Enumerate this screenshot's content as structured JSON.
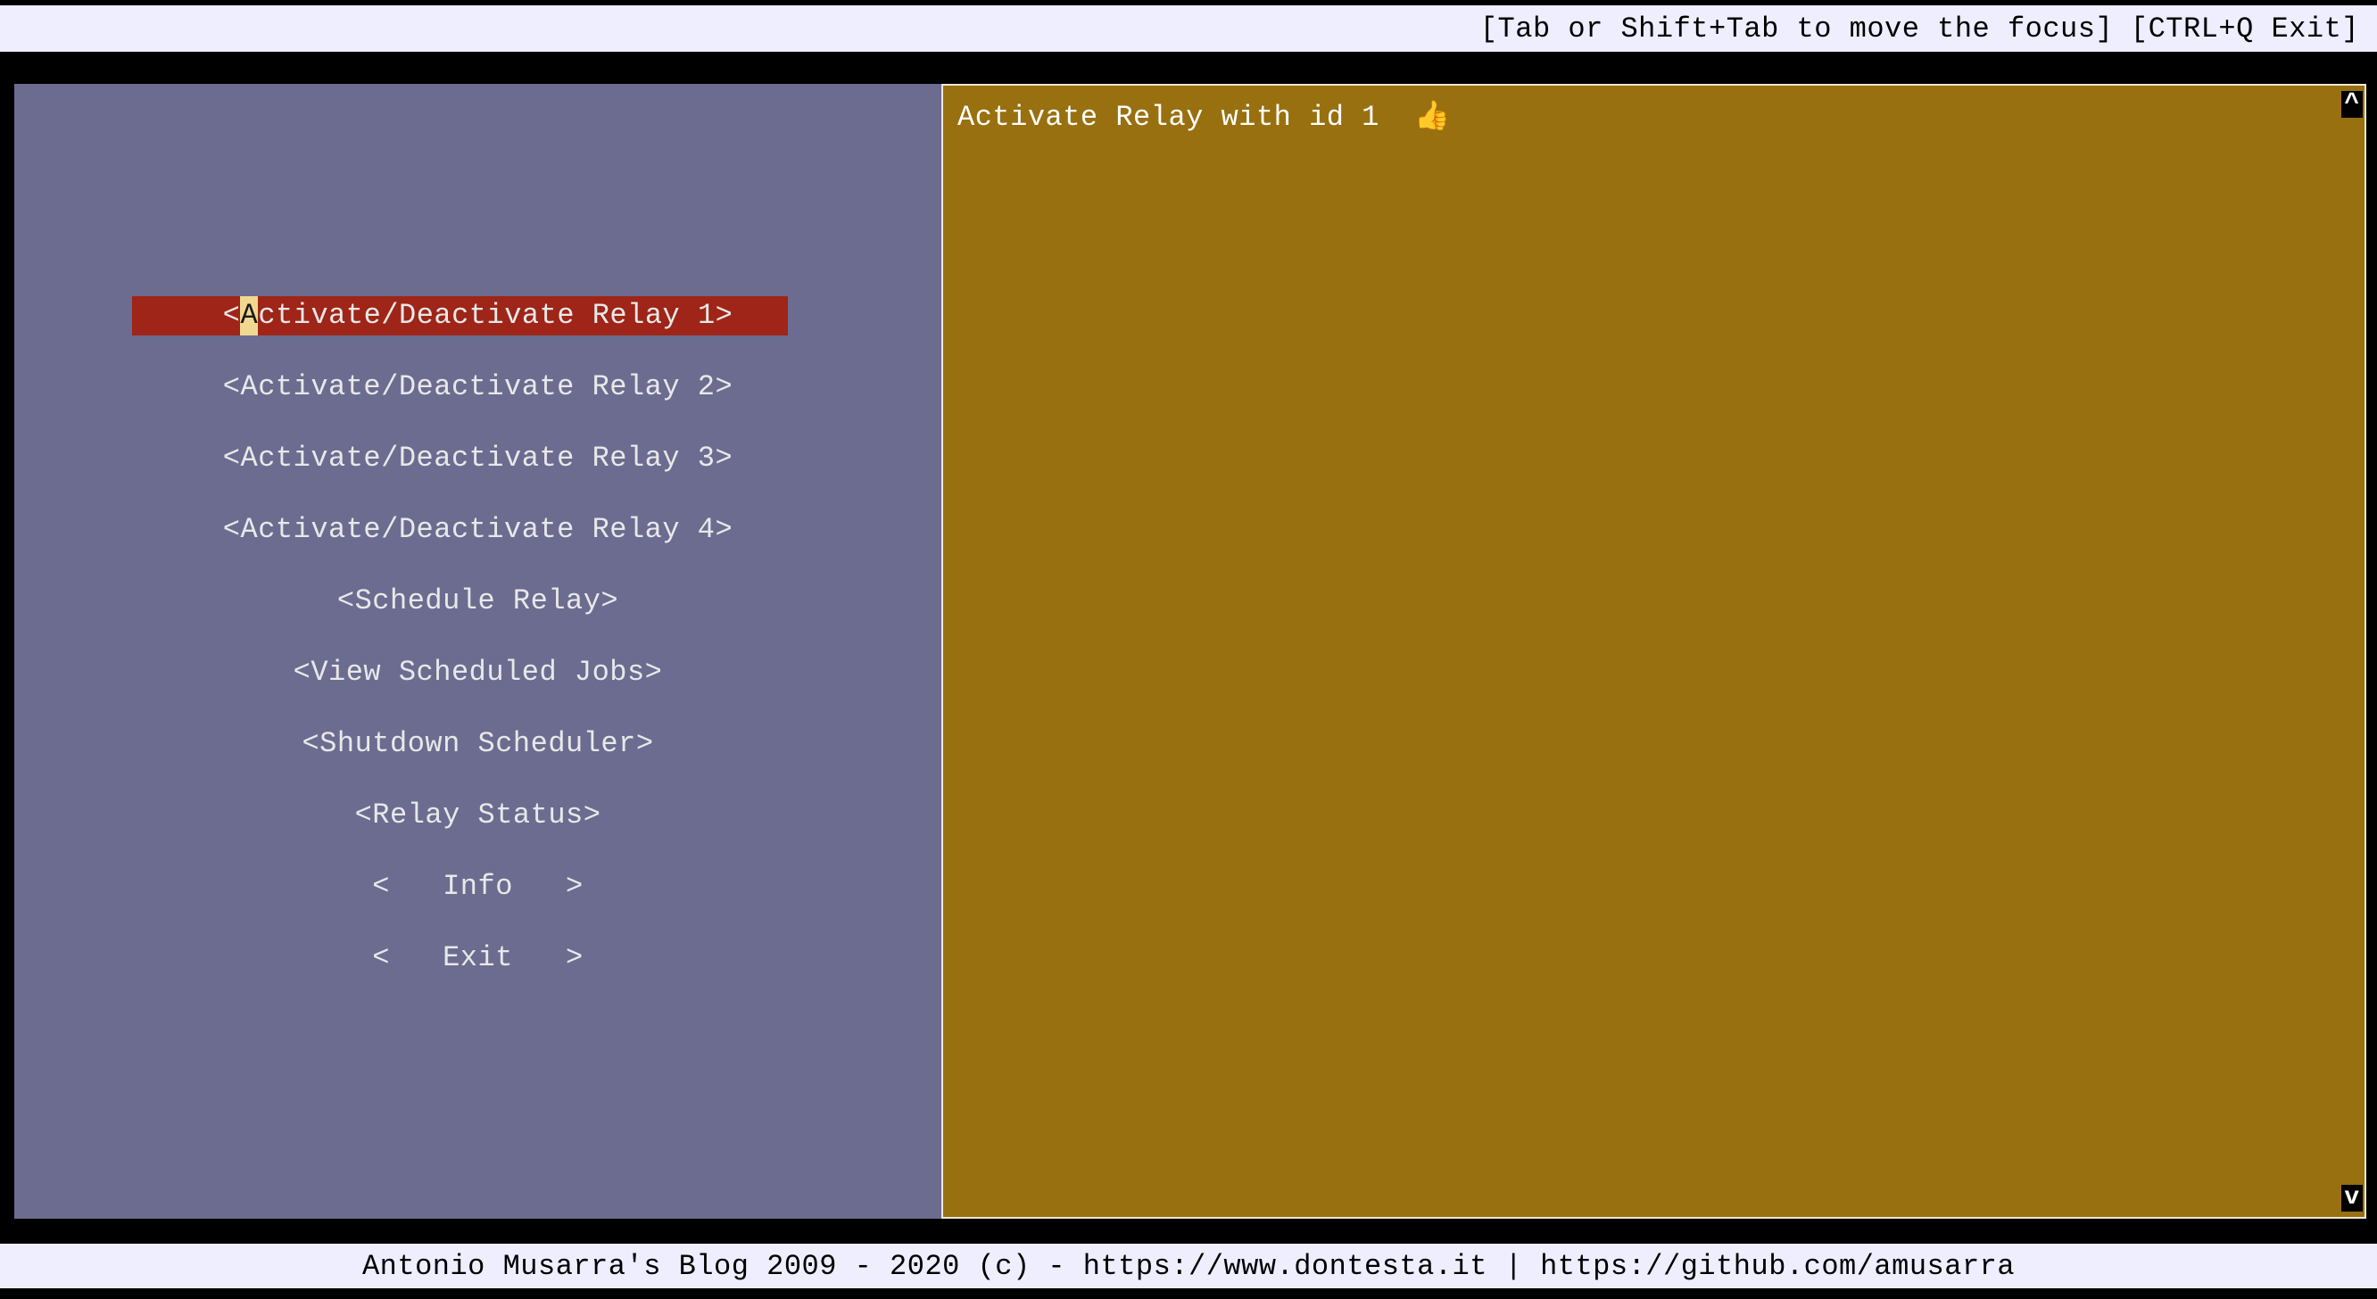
{
  "topbar": {
    "hint": "[Tab or Shift+Tab to move the focus] [CTRL+Q Exit]"
  },
  "menu": {
    "items": [
      {
        "label": "<Activate/Deactivate Relay 1>",
        "selected": true,
        "hotkey_index": 1
      },
      {
        "label": "<Activate/Deactivate Relay 2>",
        "selected": false
      },
      {
        "label": "<Activate/Deactivate Relay 3>",
        "selected": false
      },
      {
        "label": "<Activate/Deactivate Relay 4>",
        "selected": false
      },
      {
        "label": "<Schedule Relay>",
        "selected": false
      },
      {
        "label": "<View Scheduled Jobs>",
        "selected": false
      },
      {
        "label": "<Shutdown Scheduler>",
        "selected": false
      },
      {
        "label": "<Relay Status>",
        "selected": false
      },
      {
        "label": "<   Info   >",
        "selected": false
      },
      {
        "label": "<   Exit   >",
        "selected": false
      }
    ]
  },
  "output": {
    "text": "Activate Relay with id 1  👍"
  },
  "scroll": {
    "up": "^",
    "down": "v"
  },
  "footer": {
    "text": "Antonio Musarra's Blog 2009 - 2020 (c) - https://www.dontesta.it | https://github.com/amusarra"
  }
}
